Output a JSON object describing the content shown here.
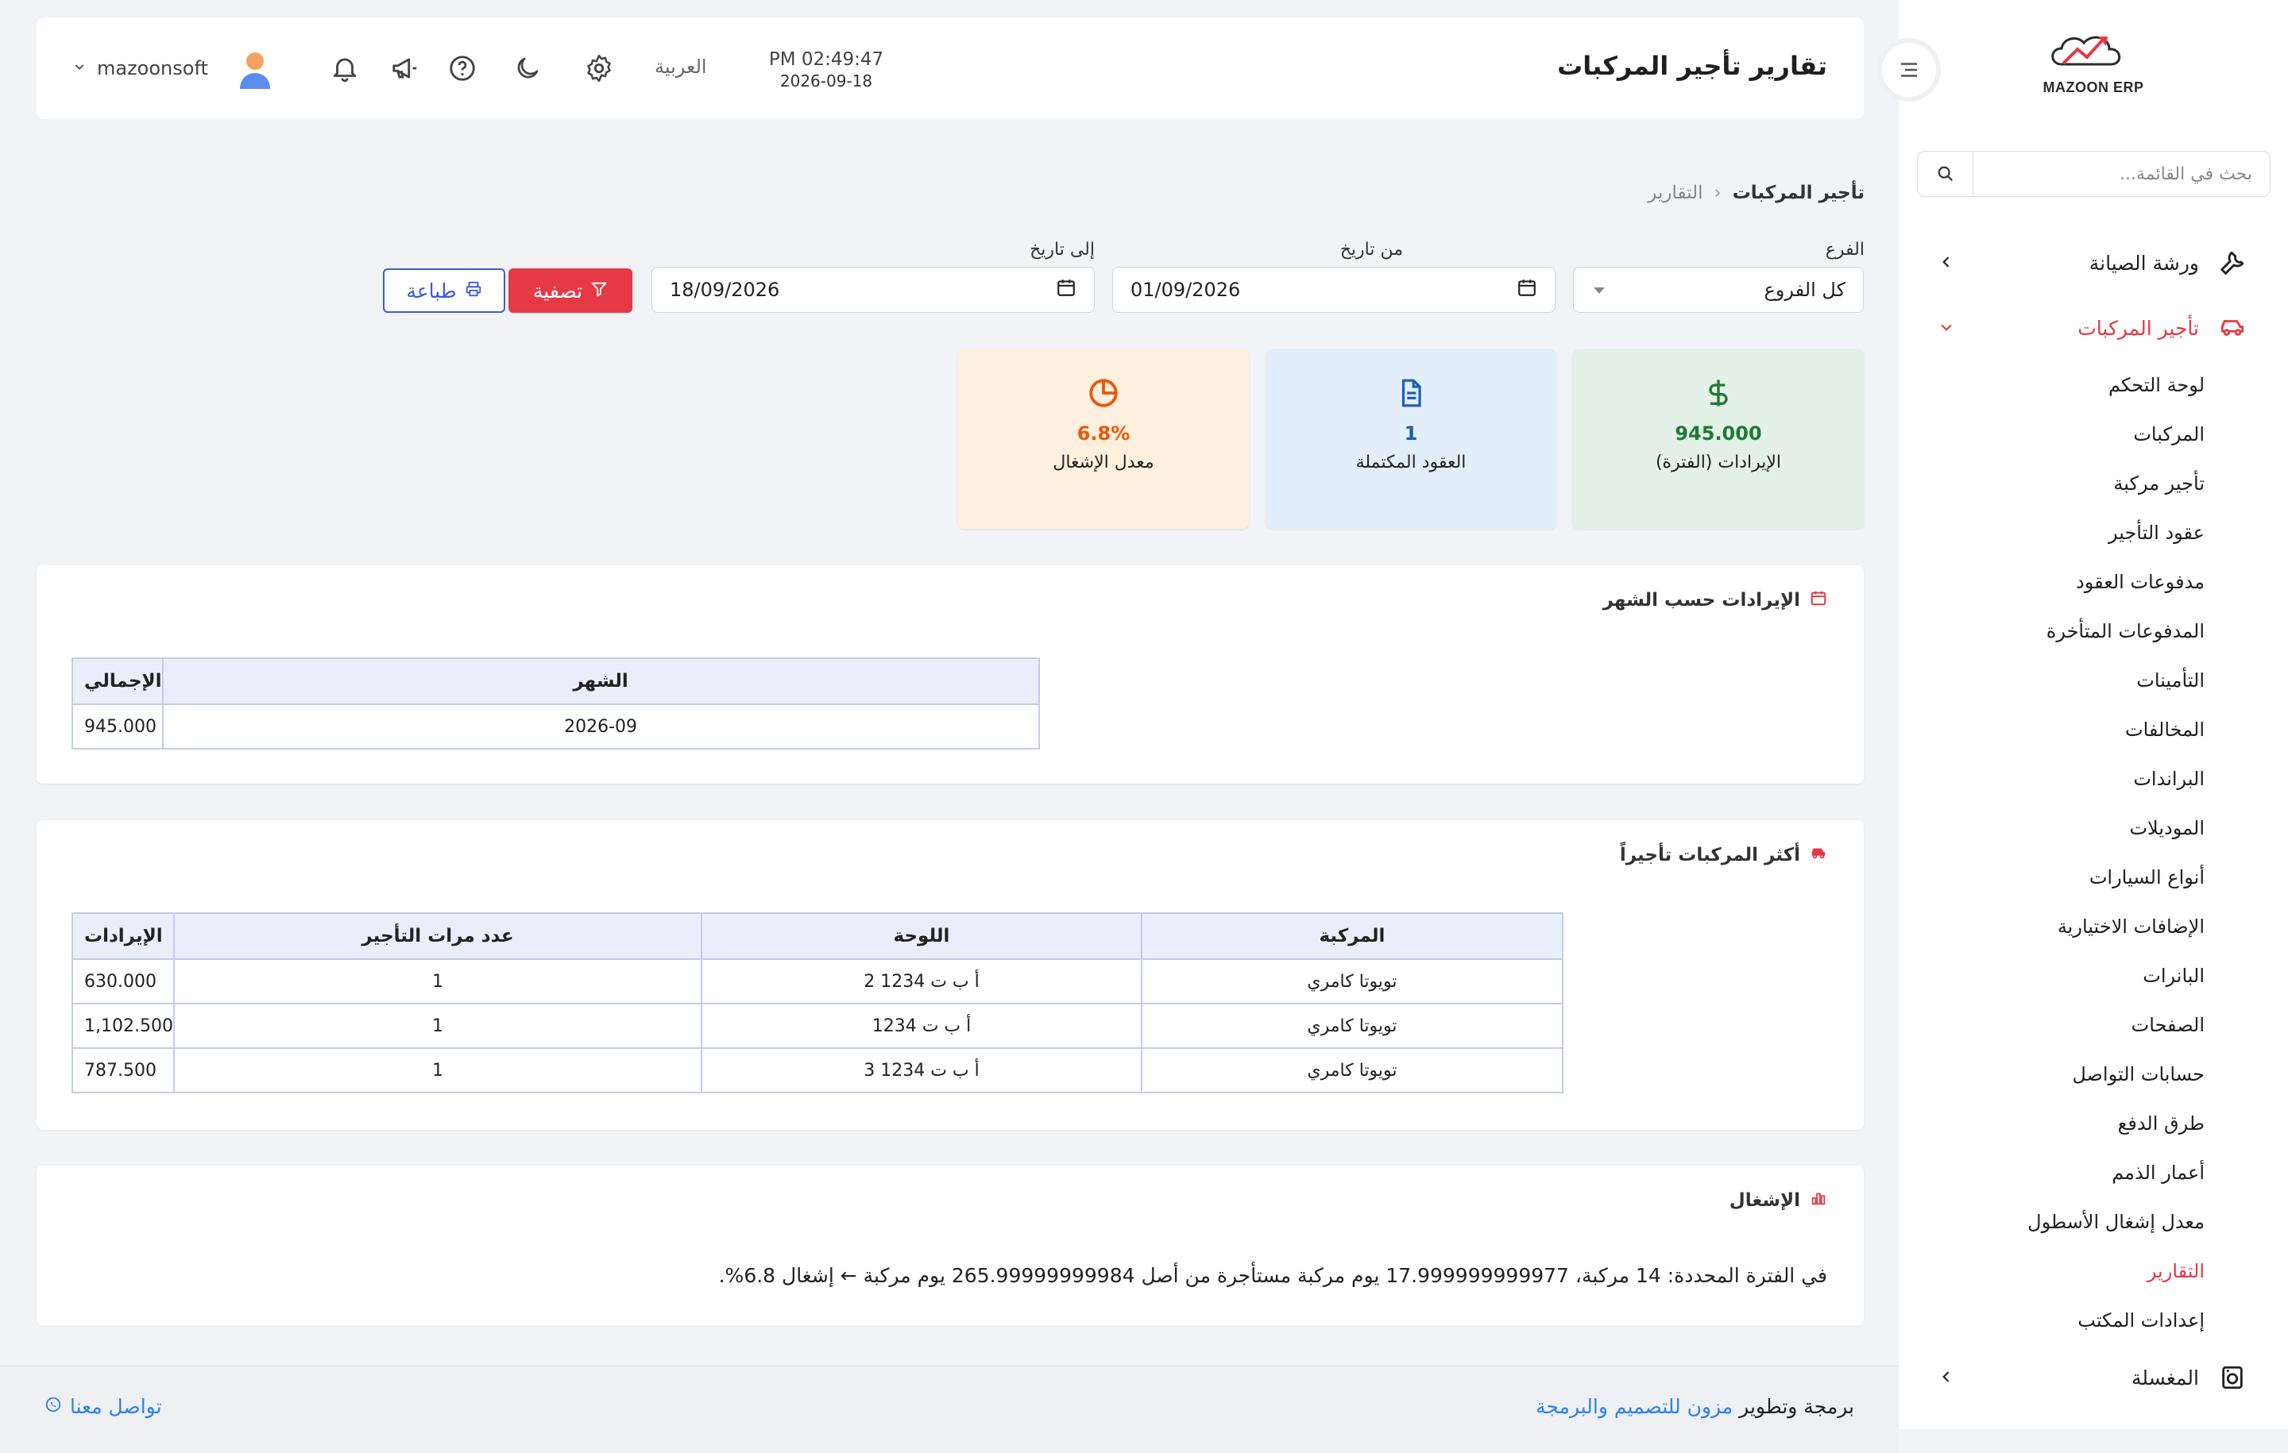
{
  "app": {
    "logo_text": "MAZOON ERP"
  },
  "header": {
    "title": "تقارير تأجير المركبات",
    "time": "PM 02:49:47",
    "date": "2026-09-18",
    "language": "العربية",
    "username": "mazoonsoft"
  },
  "sidebar": {
    "search_placeholder": "بحث في القائمة...",
    "sections": [
      {
        "label": "ورشة الصيانة",
        "icon": "wrench-icon"
      },
      {
        "label": "تأجير المركبات",
        "icon": "car-icon"
      },
      {
        "label": "المغسلة",
        "icon": "laundry-icon"
      }
    ],
    "items": [
      {
        "label": "لوحة التحكم"
      },
      {
        "label": "المركبات"
      },
      {
        "label": "تأجير مركبة"
      },
      {
        "label": "عقود التأجير"
      },
      {
        "label": "مدفوعات العقود"
      },
      {
        "label": "المدفوعات المتأخرة"
      },
      {
        "label": "التأمينات"
      },
      {
        "label": "المخالفات"
      },
      {
        "label": "البراندات"
      },
      {
        "label": "الموديلات"
      },
      {
        "label": "أنواع السيارات"
      },
      {
        "label": "الإضافات الاختيارية"
      },
      {
        "label": "البانرات"
      },
      {
        "label": "الصفحات"
      },
      {
        "label": "حسابات التواصل"
      },
      {
        "label": "طرق الدفع"
      },
      {
        "label": "أعمار الذمم"
      },
      {
        "label": "معدل إشغال الأسطول"
      },
      {
        "label": "التقارير"
      },
      {
        "label": "إعدادات المكتب"
      }
    ]
  },
  "breadcrumb": {
    "parent": "تأجير المركبات",
    "current": "التقارير"
  },
  "filters": {
    "branch_label": "الفرع",
    "branch_value": "كل الفروع",
    "from_label": "من تاريخ",
    "from_value": "01/09/2026",
    "to_label": "إلى تاريخ",
    "to_value": "18/09/2026",
    "filter_button": "تصفية",
    "print_button": "طباعة"
  },
  "stats": {
    "revenue": {
      "value": "945.000",
      "label": "الإيرادات (الفترة)"
    },
    "contracts": {
      "value": "1",
      "label": "العقود المكتملة"
    },
    "occupancy": {
      "value": "6.8%",
      "label": "معدل الإشغال"
    }
  },
  "revenue_by_month": {
    "title": "الإيرادات حسب الشهر",
    "columns": [
      "الشهر",
      "الإجمالي"
    ],
    "rows": [
      {
        "month": "2026-09",
        "total": "945.000"
      }
    ]
  },
  "top_vehicles": {
    "title": "أكثر المركبات تأجيراً",
    "columns": [
      "المركبة",
      "اللوحة",
      "عدد مرات التأجير",
      "الإيرادات"
    ],
    "rows": [
      {
        "vehicle": "تويوتا كامري",
        "plate": "أ ب ت 1234 2",
        "count": "1",
        "revenue": "630.000"
      },
      {
        "vehicle": "تويوتا كامري",
        "plate": "أ ب ت 1234",
        "count": "1",
        "revenue": "1,102.500"
      },
      {
        "vehicle": "تويوتا كامري",
        "plate": "أ ب ت 1234 3",
        "count": "1",
        "revenue": "787.500"
      }
    ]
  },
  "occupancy": {
    "title": "الإشغال",
    "text": "في الفترة المحددة: 14 مركبة، 17.999999999977 يوم مركبة مستأجرة من أصل 265.99999999984 يوم مركبة ← إشغال 6.8%."
  },
  "footer": {
    "credit_prefix": "برمجة وتطوير",
    "credit_link": "مزون للتصميم والبرمجة",
    "contact": "تواصل معنا"
  },
  "colors": {
    "accent": "#e63946",
    "link": "#2f80ed",
    "primary_outline": "#3b5bdb"
  }
}
